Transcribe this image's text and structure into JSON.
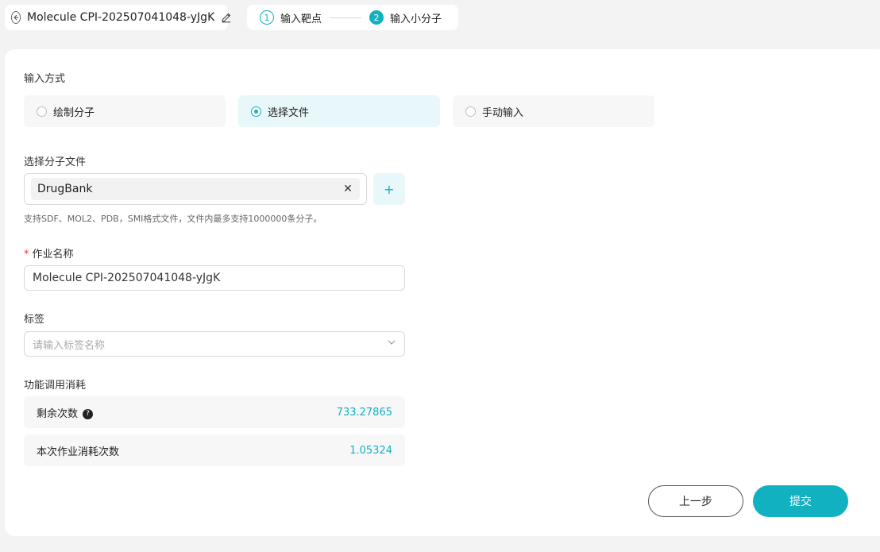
{
  "header": {
    "title": "Molecule CPI-202507041048-yJgK",
    "steps": [
      {
        "num": "1",
        "label": "输入靶点"
      },
      {
        "num": "2",
        "label": "输入小分子"
      }
    ]
  },
  "input_method": {
    "label": "输入方式",
    "options": [
      "绘制分子",
      "选择文件",
      "手动输入"
    ],
    "selected": "选择文件"
  },
  "file_select": {
    "label": "选择分子文件",
    "selected_file": "DrugBank",
    "add_label": "+",
    "hint": "支持SDF、MOL2、PDB，SMI格式文件，文件内最多支持1000000条分子。"
  },
  "job_name": {
    "label": "作业名称",
    "required_mark": "*",
    "value": "Molecule CPI-202507041048-yJgK"
  },
  "tags": {
    "label": "标签",
    "placeholder": "请输入标签名称"
  },
  "cost": {
    "label": "功能调用消耗",
    "remaining_label": "剩余次数",
    "remaining_value": "733.27865",
    "job_cost_label": "本次作业消耗次数",
    "job_cost_value": "1.05324"
  },
  "actions": {
    "prev_label": "上一步",
    "submit_label": "提交"
  },
  "colors": {
    "accent": "#12b1c2",
    "selected_bg": "#e8f7f9"
  }
}
